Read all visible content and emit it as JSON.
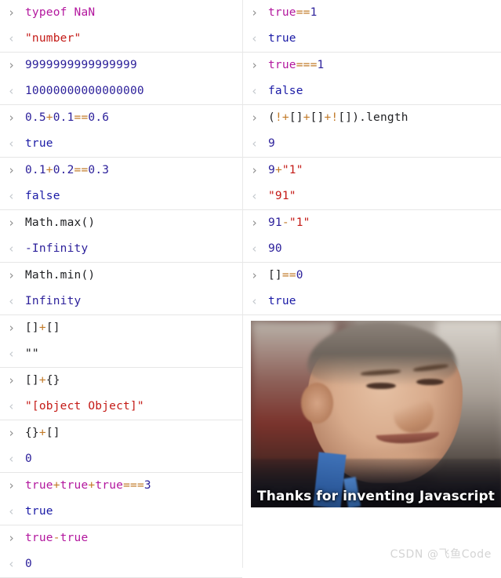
{
  "console": {
    "prompt_input_glyph": "›",
    "prompt_output_glyph": "‹",
    "left_column": [
      {
        "input_tokens": [
          {
            "t": "typeof ",
            "c": "kw"
          },
          {
            "t": "NaN",
            "c": "kw"
          }
        ],
        "input_text": "typeof NaN",
        "output_tokens": [
          {
            "t": "\"number\"",
            "c": "str"
          }
        ],
        "output_text": "\"number\""
      },
      {
        "input_tokens": [
          {
            "t": "9999999999999999",
            "c": "num"
          }
        ],
        "input_text": "9999999999999999",
        "output_tokens": [
          {
            "t": "10000000000000000",
            "c": "num"
          }
        ],
        "output_text": "10000000000000000"
      },
      {
        "input_tokens": [
          {
            "t": "0.5",
            "c": "num"
          },
          {
            "t": "+",
            "c": "op"
          },
          {
            "t": "0.1",
            "c": "num"
          },
          {
            "t": "==",
            "c": "op"
          },
          {
            "t": "0.6",
            "c": "num"
          }
        ],
        "input_text": "0.5+0.1==0.6",
        "output_tokens": [
          {
            "t": "true",
            "c": "bool"
          }
        ],
        "output_text": "true"
      },
      {
        "input_tokens": [
          {
            "t": "0.1",
            "c": "num"
          },
          {
            "t": "+",
            "c": "op"
          },
          {
            "t": "0.2",
            "c": "num"
          },
          {
            "t": "==",
            "c": "op"
          },
          {
            "t": "0.3",
            "c": "num"
          }
        ],
        "input_text": "0.1+0.2==0.3",
        "output_tokens": [
          {
            "t": "false",
            "c": "bool"
          }
        ],
        "output_text": "false"
      },
      {
        "input_tokens": [
          {
            "t": "Math.max()",
            "c": "pl"
          }
        ],
        "input_text": "Math.max()",
        "output_tokens": [
          {
            "t": "-Infinity",
            "c": "num"
          }
        ],
        "output_text": "-Infinity"
      },
      {
        "input_tokens": [
          {
            "t": "Math.min()",
            "c": "pl"
          }
        ],
        "input_text": "Math.min()",
        "output_tokens": [
          {
            "t": "Infinity",
            "c": "num"
          }
        ],
        "output_text": "Infinity"
      },
      {
        "input_tokens": [
          {
            "t": "[]",
            "c": "pl"
          },
          {
            "t": "+",
            "c": "op"
          },
          {
            "t": "[]",
            "c": "pl"
          }
        ],
        "input_text": "[]+[]",
        "output_tokens": [
          {
            "t": "\"\"",
            "c": "dim"
          }
        ],
        "output_text": "\"\""
      },
      {
        "input_tokens": [
          {
            "t": "[]",
            "c": "pl"
          },
          {
            "t": "+",
            "c": "op"
          },
          {
            "t": "{}",
            "c": "pl"
          }
        ],
        "input_text": "[]+{}",
        "output_tokens": [
          {
            "t": "\"[object Object]\"",
            "c": "str"
          }
        ],
        "output_text": "\"[object Object]\""
      },
      {
        "input_tokens": [
          {
            "t": "{}",
            "c": "pl"
          },
          {
            "t": "+",
            "c": "op"
          },
          {
            "t": "[]",
            "c": "pl"
          }
        ],
        "input_text": "{}+[]",
        "output_tokens": [
          {
            "t": "0",
            "c": "num"
          }
        ],
        "output_text": "0"
      },
      {
        "input_tokens": [
          {
            "t": "true",
            "c": "kw"
          },
          {
            "t": "+",
            "c": "op"
          },
          {
            "t": "true",
            "c": "kw"
          },
          {
            "t": "+",
            "c": "op"
          },
          {
            "t": "true",
            "c": "kw"
          },
          {
            "t": "===",
            "c": "op"
          },
          {
            "t": "3",
            "c": "num"
          }
        ],
        "input_text": "true+true+true===3",
        "output_tokens": [
          {
            "t": "true",
            "c": "bool"
          }
        ],
        "output_text": "true"
      },
      {
        "input_tokens": [
          {
            "t": "true",
            "c": "kw"
          },
          {
            "t": "-",
            "c": "op"
          },
          {
            "t": "true",
            "c": "kw"
          }
        ],
        "input_text": "true-true",
        "output_tokens": [
          {
            "t": "0",
            "c": "num"
          }
        ],
        "output_text": "0"
      }
    ],
    "right_column": [
      {
        "input_tokens": [
          {
            "t": "true",
            "c": "kw"
          },
          {
            "t": "==",
            "c": "op"
          },
          {
            "t": "1",
            "c": "num"
          }
        ],
        "input_text": "true==1",
        "output_tokens": [
          {
            "t": "true",
            "c": "bool"
          }
        ],
        "output_text": "true"
      },
      {
        "input_tokens": [
          {
            "t": "true",
            "c": "kw"
          },
          {
            "t": "===",
            "c": "op"
          },
          {
            "t": "1",
            "c": "num"
          }
        ],
        "input_text": "true===1",
        "output_tokens": [
          {
            "t": "false",
            "c": "bool"
          }
        ],
        "output_text": "false"
      },
      {
        "input_tokens": [
          {
            "t": "(",
            "c": "pl"
          },
          {
            "t": "!+",
            "c": "op"
          },
          {
            "t": "[]",
            "c": "pl"
          },
          {
            "t": "+",
            "c": "op"
          },
          {
            "t": "[]",
            "c": "pl"
          },
          {
            "t": "+!",
            "c": "op"
          },
          {
            "t": "[]).length",
            "c": "pl"
          }
        ],
        "input_text": "(!+[]+[]+![]).length",
        "output_tokens": [
          {
            "t": "9",
            "c": "num"
          }
        ],
        "output_text": "9"
      },
      {
        "input_tokens": [
          {
            "t": "9",
            "c": "num"
          },
          {
            "t": "+",
            "c": "op"
          },
          {
            "t": "\"1\"",
            "c": "str"
          }
        ],
        "input_text": "9+\"1\"",
        "output_tokens": [
          {
            "t": "\"91\"",
            "c": "str"
          }
        ],
        "output_text": "\"91\""
      },
      {
        "input_tokens": [
          {
            "t": "91",
            "c": "num"
          },
          {
            "t": "-",
            "c": "op"
          },
          {
            "t": "\"1\"",
            "c": "str"
          }
        ],
        "input_text": "91-\"1\"",
        "output_tokens": [
          {
            "t": "90",
            "c": "num"
          }
        ],
        "output_text": "90"
      },
      {
        "input_tokens": [
          {
            "t": "[]",
            "c": "pl"
          },
          {
            "t": "==",
            "c": "op"
          },
          {
            "t": "0",
            "c": "num"
          }
        ],
        "input_text": "[]==0",
        "output_tokens": [
          {
            "t": "true",
            "c": "bool"
          }
        ],
        "output_text": "true"
      }
    ]
  },
  "photo": {
    "caption": "Thanks for inventing Javascript",
    "alt": "portrait-of-smiling-man"
  },
  "watermark": {
    "text": "CSDN @飞鱼Code"
  },
  "colors": {
    "keyword": "#b3179e",
    "number": "#2d219b",
    "operator": "#c27a28",
    "string": "#c41a16",
    "boolean": "#1a1aa6",
    "plain": "#202124",
    "divider": "#e6e6e6",
    "background": "#ffffff",
    "watermark": "#d4d4d4"
  }
}
